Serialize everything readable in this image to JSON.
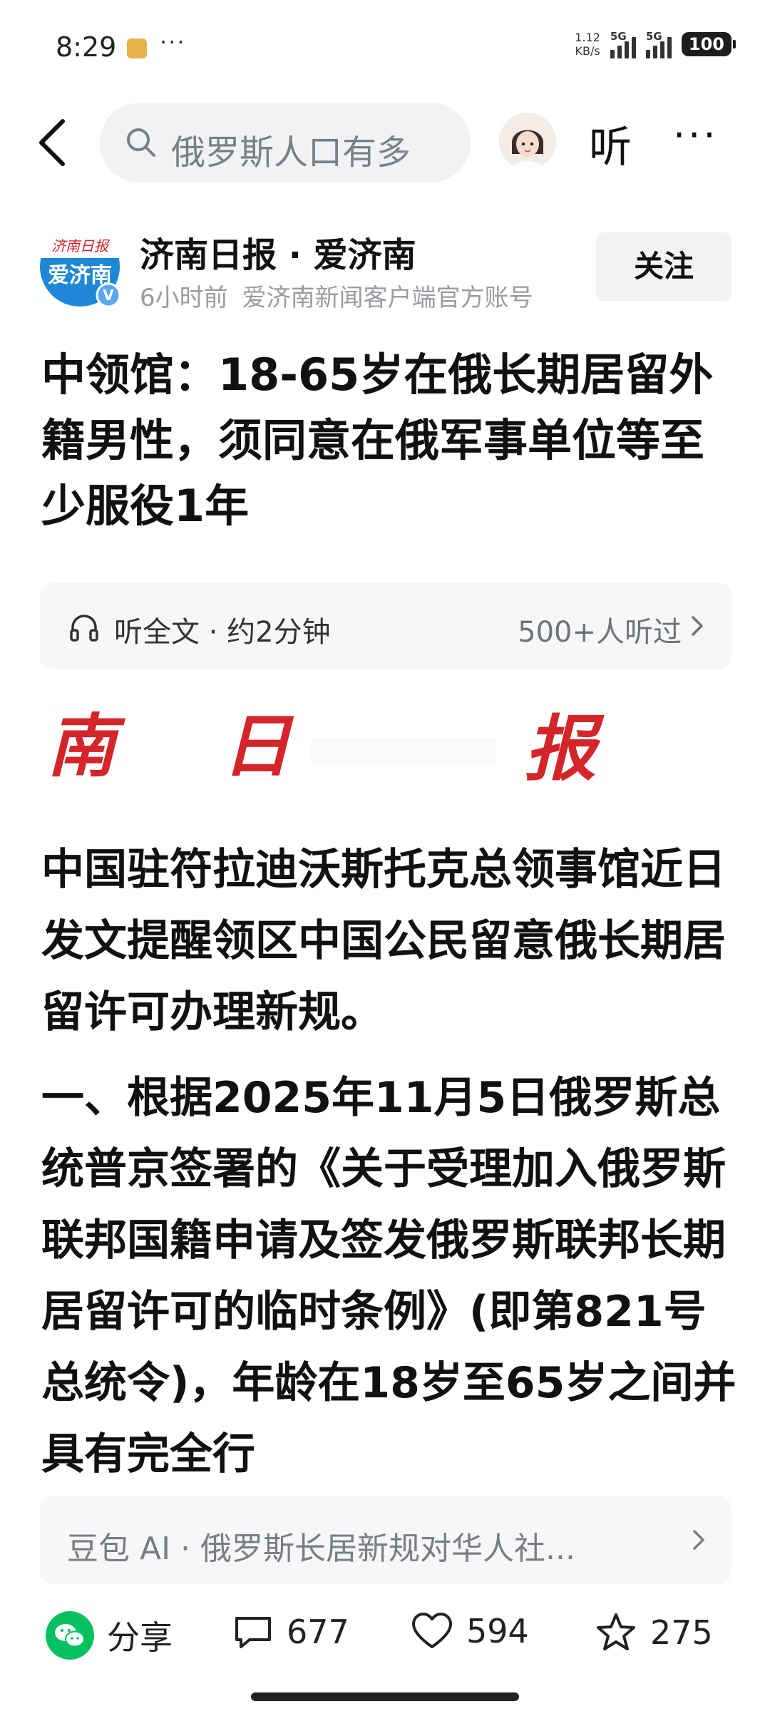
{
  "status_bar": {
    "time": "8:29",
    "dots": "···",
    "net_speed_value": "1.12",
    "net_speed_unit": "KB/s",
    "signal1_label": "5G",
    "signal2_label": "5G",
    "battery": "100"
  },
  "nav": {
    "search_text": "俄罗斯人口有多",
    "listen_label": "听",
    "more_label": "···"
  },
  "author": {
    "logo_text_top": "济南日报",
    "logo_text_main": "爱济南",
    "verified_badge": "V",
    "name": "济南日报 · 爱济南",
    "time_ago": "6小时前",
    "description": "爱济南新闻客户端官方账号",
    "follow_label": "关注"
  },
  "article": {
    "title": "中领馆：18-65岁在俄长期居留外籍男性，须同意在俄军事单位等至少服役1年",
    "listen_bar": {
      "label": "听全文 · 约2分钟",
      "count": "500+人听过"
    },
    "masthead_chars": [
      "南",
      "日",
      "报"
    ],
    "paragraphs": [
      "中国驻符拉迪沃斯托克总领事馆近日发文提醒领区中国公民留意俄长期居留许可办理新规。",
      "一、根据2025年11月5日俄罗斯总统普京签署的《关于受理加入俄罗斯联邦国籍申请及签发俄罗斯联邦长期居留许可的临时条例》(即第821号总统令)，年龄在18岁至65岁之间并具有完全行"
    ]
  },
  "ai_bar": {
    "label": "豆包 AI · 俄罗斯长居新规对华人社..."
  },
  "bottom_bar": {
    "share_label": "分享",
    "comments": "677",
    "likes": "594",
    "favorites": "275"
  },
  "colors": {
    "accent_green": "#07c160",
    "masthead_red": "#d3252a",
    "logo_blue": "#1e88d6"
  }
}
